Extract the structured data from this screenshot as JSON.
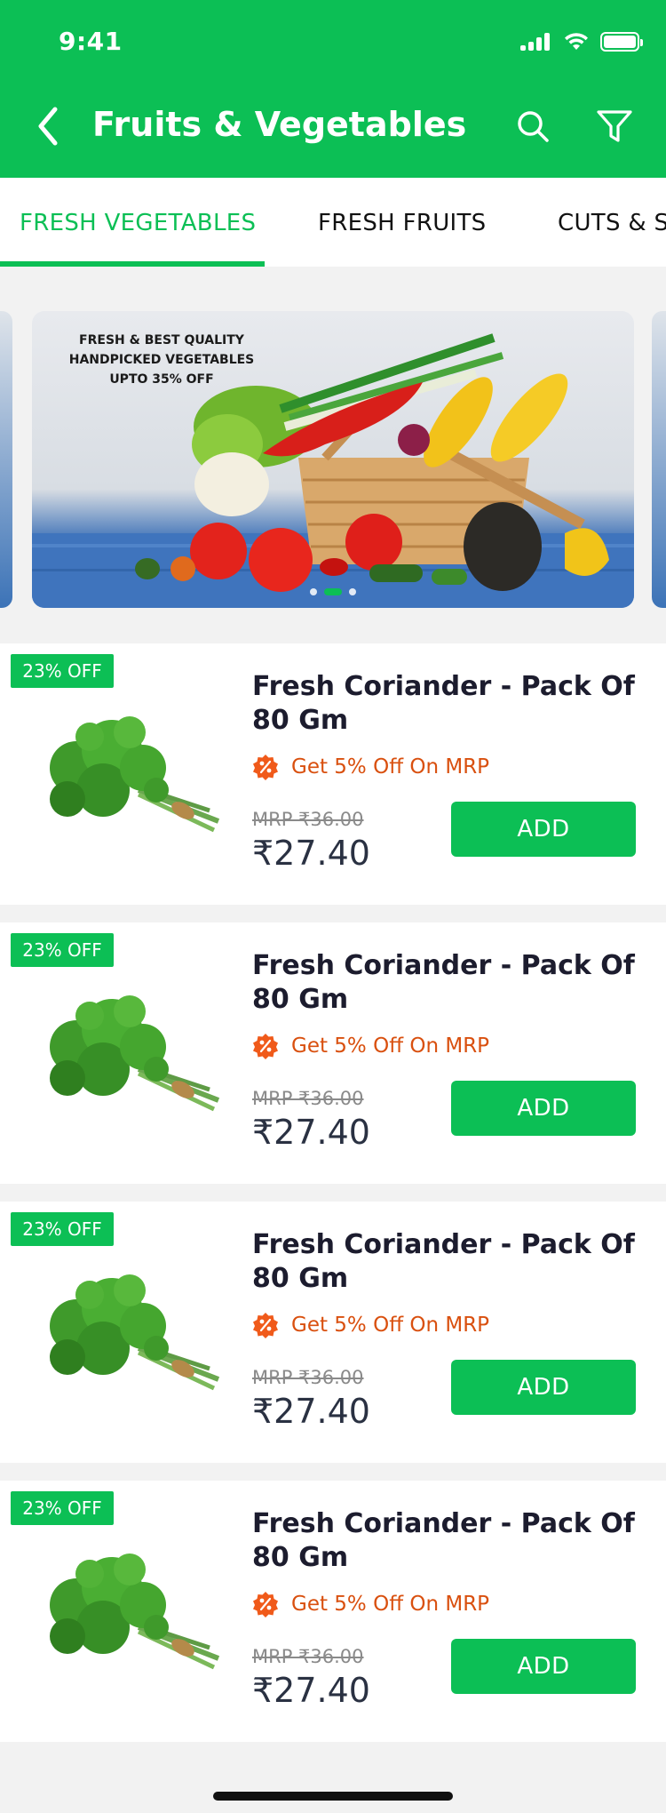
{
  "status_bar": {
    "time": "9:41"
  },
  "header": {
    "title": "Fruits & Vegetables",
    "icons": [
      "back-chevron-icon",
      "search-icon",
      "filter-icon"
    ]
  },
  "tabs": [
    {
      "label": "FRESH VEGETABLES",
      "active": true
    },
    {
      "label": "FRESH FRUITS",
      "active": false
    },
    {
      "label": "CUTS & SPROUTS",
      "active": false
    }
  ],
  "banner": {
    "promo_lines": [
      "FRESH & BEST QUALITY",
      "HANDPICKED VEGETABLES",
      "UPTO 35% OFF"
    ],
    "dots": 3,
    "active_dot": 2
  },
  "products": [
    {
      "badge": "23% OFF",
      "name": "Fresh Coriander - Pack Of 80 Gm",
      "offer": "Get 5% Off On MRP",
      "mrp": "MRP ₹36.00",
      "price": "₹27.40",
      "button": "ADD"
    },
    {
      "badge": "23% OFF",
      "name": "Fresh Coriander - Pack Of 80 Gm",
      "offer": "Get 5% Off On MRP",
      "mrp": "MRP ₹36.00",
      "price": "₹27.40",
      "button": "ADD"
    },
    {
      "badge": "23% OFF",
      "name": "Fresh Coriander - Pack Of 80 Gm",
      "offer": "Get 5% Off On MRP",
      "mrp": "MRP ₹36.00",
      "price": "₹27.40",
      "button": "ADD"
    },
    {
      "badge": "23% OFF",
      "name": "Fresh Coriander - Pack Of 80 Gm",
      "offer": "Get 5% Off On MRP",
      "mrp": "MRP ₹36.00",
      "price": "₹27.40",
      "button": "ADD"
    }
  ],
  "colors": {
    "brand_green": "#0cbf55",
    "offer_orange": "#d9500f",
    "price_text": "#2a3142"
  }
}
